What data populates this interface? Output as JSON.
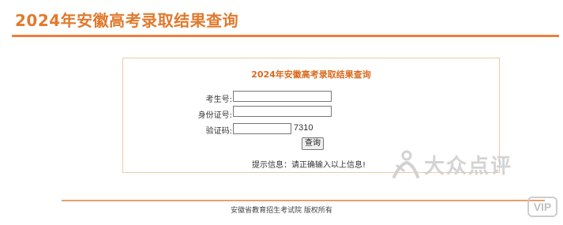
{
  "header": {
    "title": "2024年安徽高考录取结果查询"
  },
  "form": {
    "title": "2024年安徽高考录取结果查询",
    "exam_number_label": "考生号:",
    "exam_number_value": "",
    "id_number_label": "身份证号:",
    "id_number_value": "",
    "captcha_label": "验证码:",
    "captcha_value": "",
    "captcha_code": "7310",
    "submit_label": "查询",
    "hint": "提示信息：请正确输入以上信息!"
  },
  "footer": {
    "copyright": "安徽省教育招生考试院 版权所有"
  },
  "watermark": {
    "brand_text": "大众点评",
    "vip_label": "VIP",
    "logo_icon": "dianping-logo-icon"
  },
  "colors": {
    "accent": "#e07a2e",
    "rule": "#e8833a",
    "box_border": "#efc9a6"
  }
}
